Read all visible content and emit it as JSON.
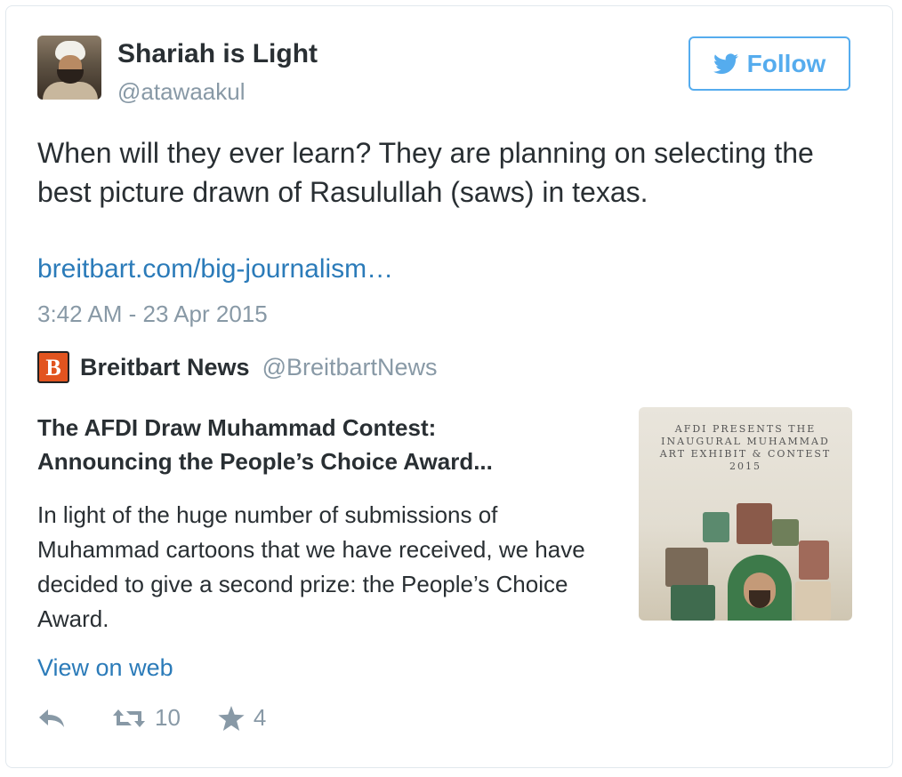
{
  "tweet": {
    "author_name": "Shariah is Light",
    "author_handle": "@atawaakul",
    "follow_label": "Follow",
    "text": "When will they ever learn? They are planning on selecting the best picture drawn of Rasulullah (saws) in texas.",
    "link": "breitbart.com/big-journalism…",
    "timestamp": "3:42 AM - 23 Apr 2015"
  },
  "card": {
    "source_logo_letter": "B",
    "source_name": "Breitbart News",
    "source_handle": "@BreitbartNews",
    "title_line1": "The AFDI Draw Muhammad Contest:",
    "title_line2": "Announcing the People’s Choice Award...",
    "description": "In light of the huge number of submissions of Muhammad cartoons that we have received, we have decided to give a second prize: the People’s Choice Award.",
    "image_text": "AFDI PRESENTS THE INAUGURAL MUHAMMAD ART EXHIBIT & CONTEST 2015",
    "view_on_web": "View on web"
  },
  "actions": {
    "retweet_count": "10",
    "favorite_count": "4"
  },
  "colors": {
    "accent": "#55acee",
    "link": "#2b7bb9",
    "muted": "#8899a6",
    "text": "#292f33"
  },
  "icons": [
    "twitter-bird-icon",
    "reply-icon",
    "retweet-icon",
    "star-icon"
  ]
}
